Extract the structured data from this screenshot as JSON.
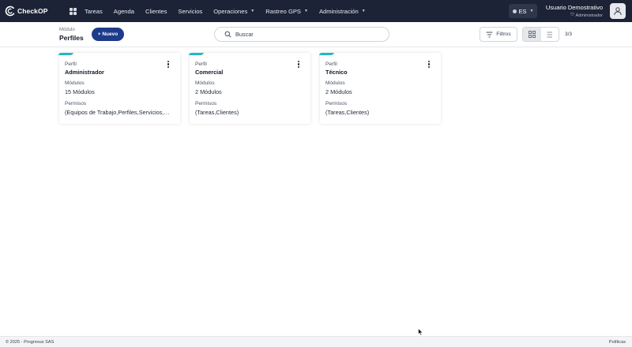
{
  "app": {
    "logo_text": "CheckOP"
  },
  "nav": {
    "items": [
      {
        "label": "Tareas",
        "dropdown": false
      },
      {
        "label": "Agenda",
        "dropdown": false
      },
      {
        "label": "Clientes",
        "dropdown": false
      },
      {
        "label": "Servicios",
        "dropdown": false
      },
      {
        "label": "Operaciones",
        "dropdown": true
      },
      {
        "label": "Rastreo GPS",
        "dropdown": true
      },
      {
        "label": "Administración",
        "dropdown": true
      }
    ],
    "language": "ES",
    "user_name": "Usuario Demostrativo",
    "user_role": "Administrador"
  },
  "header": {
    "module_label": "Módulo",
    "title": "Perfiles",
    "new_button": "+ Nuevo",
    "search_placeholder": "Buscar",
    "filter_label": "Filtros",
    "count": "3/3"
  },
  "cards": [
    {
      "profile_label": "Perfil",
      "profile": "Administrador",
      "modules_label": "Módulos",
      "modules": "15 Módulos",
      "perms_label": "Permisos",
      "perms": "(Equipos de Trabajo,Perfiles,Servicios,Clientes,Tareas)"
    },
    {
      "profile_label": "Perfil",
      "profile": "Comercial",
      "modules_label": "Módulos",
      "modules": "2 Módulos",
      "perms_label": "Permisos",
      "perms": "(Tareas,Clientes)"
    },
    {
      "profile_label": "Perfil",
      "profile": "Técnico",
      "modules_label": "Módulos",
      "modules": "2 Módulos",
      "perms_label": "Permisos",
      "perms": "(Tareas,Clientes)"
    }
  ],
  "footer": {
    "copyright": "© 2025 - Progresus SAS",
    "policies": "Políticas"
  },
  "colors": {
    "navbar": "#1c2336",
    "primary_button": "#1e3a8a",
    "card_accent": "#22b8c5"
  }
}
